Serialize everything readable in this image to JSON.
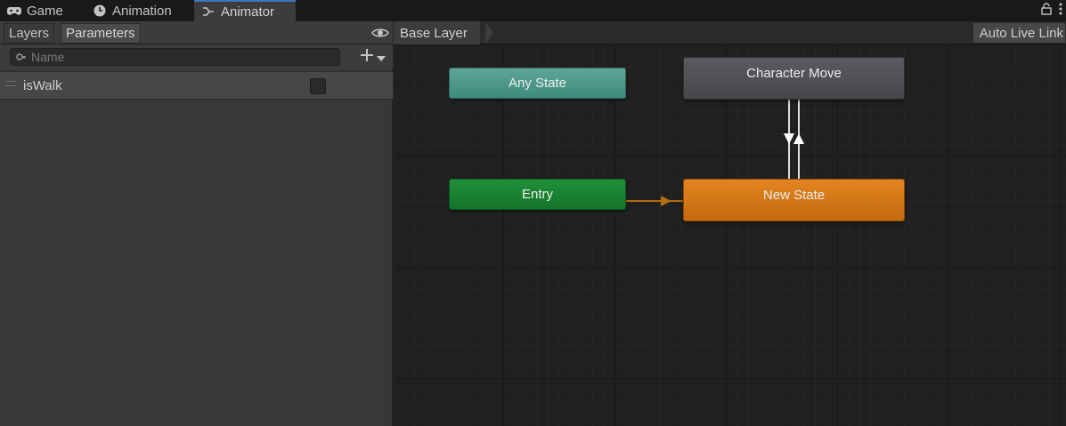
{
  "tabs": [
    {
      "label": "Game",
      "icon": "gamepad-icon"
    },
    {
      "label": "Animation",
      "icon": "clock-icon"
    },
    {
      "label": "Animator",
      "icon": "animator-icon"
    }
  ],
  "left_panel": {
    "tabs": [
      {
        "label": "Layers"
      },
      {
        "label": "Parameters"
      }
    ],
    "search": {
      "placeholder": "Name",
      "value": ""
    },
    "parameters": [
      {
        "name": "isWalk",
        "type": "bool",
        "checked": false
      }
    ]
  },
  "graph": {
    "breadcrumb": "Base Layer",
    "auto_live_link": "Auto Live Link",
    "states": {
      "any_state": "Any State",
      "entry": "Entry",
      "character_move": "Character Move",
      "new_state": "New State"
    }
  },
  "colors": {
    "accent_tab": "#3a79bb",
    "any_state": "#4f9a8c",
    "entry": "#1a8332",
    "default_state": "#d67818",
    "state": "#505154",
    "transition_default": "#b06e10",
    "transition": "#e0e0e0"
  }
}
